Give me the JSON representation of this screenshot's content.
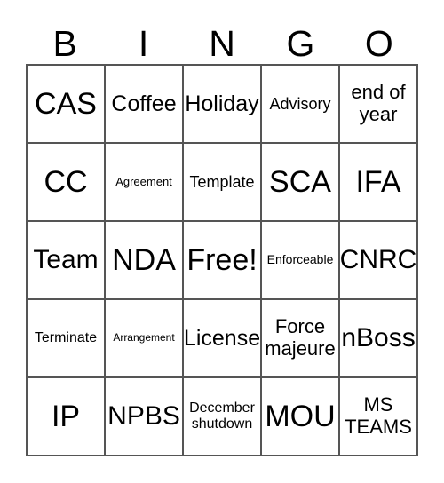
{
  "card": {
    "headers": [
      "B",
      "I",
      "N",
      "G",
      "O"
    ],
    "rows": [
      [
        {
          "text": "CAS",
          "size": "fs-xxl"
        },
        {
          "text": "Coffee",
          "size": "fs-lg"
        },
        {
          "text": "Holiday",
          "size": "fs-lg"
        },
        {
          "text": "Advisory",
          "size": "fs-sm"
        },
        {
          "text": "end of\nyear",
          "size": "fs-md"
        }
      ],
      [
        {
          "text": "CC",
          "size": "fs-xxl"
        },
        {
          "text": "Agreement",
          "size": "fs-tiny"
        },
        {
          "text": "Template",
          "size": "fs-sm"
        },
        {
          "text": "SCA",
          "size": "fs-xxl"
        },
        {
          "text": "IFA",
          "size": "fs-xxl"
        }
      ],
      [
        {
          "text": "Team",
          "size": "fs-xl"
        },
        {
          "text": "NDA",
          "size": "fs-xxl"
        },
        {
          "text": "Free!",
          "size": "fs-xxl"
        },
        {
          "text": "Enforceable",
          "size": "fs-xxs"
        },
        {
          "text": "CNRC",
          "size": "fs-xl"
        }
      ],
      [
        {
          "text": "Terminate",
          "size": "fs-xs"
        },
        {
          "text": "Arrangement",
          "size": "fs-micro"
        },
        {
          "text": "License",
          "size": "fs-lg"
        },
        {
          "text": "Force\nmajeure",
          "size": "fs-md"
        },
        {
          "text": "nBoss",
          "size": "fs-xl"
        }
      ],
      [
        {
          "text": "IP",
          "size": "fs-xxl"
        },
        {
          "text": "NPBS",
          "size": "fs-xl"
        },
        {
          "text": "December\nshutdown",
          "size": "fs-xs"
        },
        {
          "text": "MOU",
          "size": "fs-xxl"
        },
        {
          "text": "MS\nTEAMS",
          "size": "fs-md"
        }
      ]
    ],
    "free_space_label": "Free!",
    "colors": {
      "background": "#ffffff",
      "text": "#000000",
      "grid_line": "#555555"
    }
  }
}
